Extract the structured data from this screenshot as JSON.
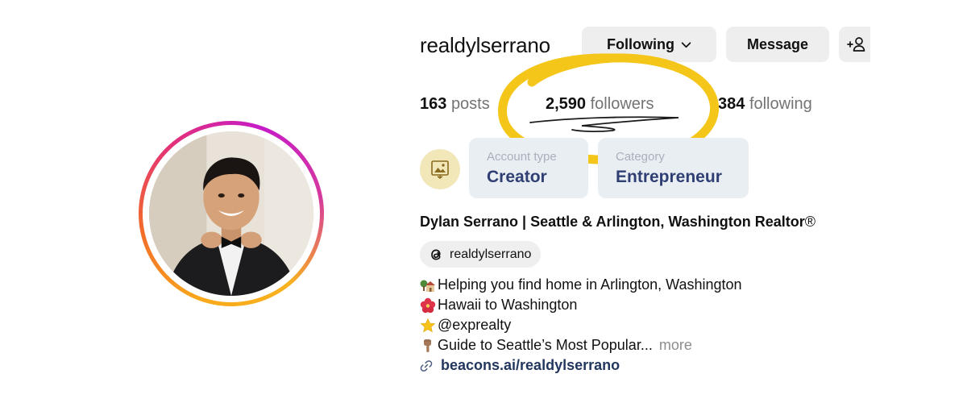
{
  "profile": {
    "username": "realdylserrano",
    "full_name": "Dylan Serrano | Seattle & Arlington, Washington Realtor",
    "registered_mark": "®"
  },
  "actions": {
    "following_label": "Following",
    "message_label": "Message",
    "add_user_icon": "add-user-icon"
  },
  "stats": {
    "posts_count": "163",
    "posts_label": "posts",
    "followers_count": "2,590",
    "followers_label": "followers",
    "following_count": "384",
    "following_label": "following"
  },
  "info_cards": {
    "account_type_label": "Account type",
    "account_type_value": "Creator",
    "category_label": "Category",
    "category_value": "Entrepreneur",
    "icon": "framed-picture-icon"
  },
  "threads": {
    "handle": "realdylserrano",
    "icon": "threads-icon"
  },
  "bio": {
    "lines": [
      {
        "emoji": "house-with-garden-icon",
        "text": "Helping you find home in Arlington, Washington"
      },
      {
        "emoji": "hibiscus-icon",
        "text": "Hawaii to Washington"
      },
      {
        "emoji": "star-icon",
        "text": "@exprealty"
      },
      {
        "emoji": "pointing-down-icon",
        "text": "Guide to Seattle’s Most Popular..."
      }
    ],
    "more_label": "more"
  },
  "link": {
    "text": "beacons.ai/realdylserrano",
    "icon": "link-icon"
  },
  "colors": {
    "highlight_circle": "#f5c61a",
    "card_background": "#e9eef3",
    "card_value": "#2f3f73",
    "link": "#22375e",
    "button_background": "#eeeeee"
  }
}
